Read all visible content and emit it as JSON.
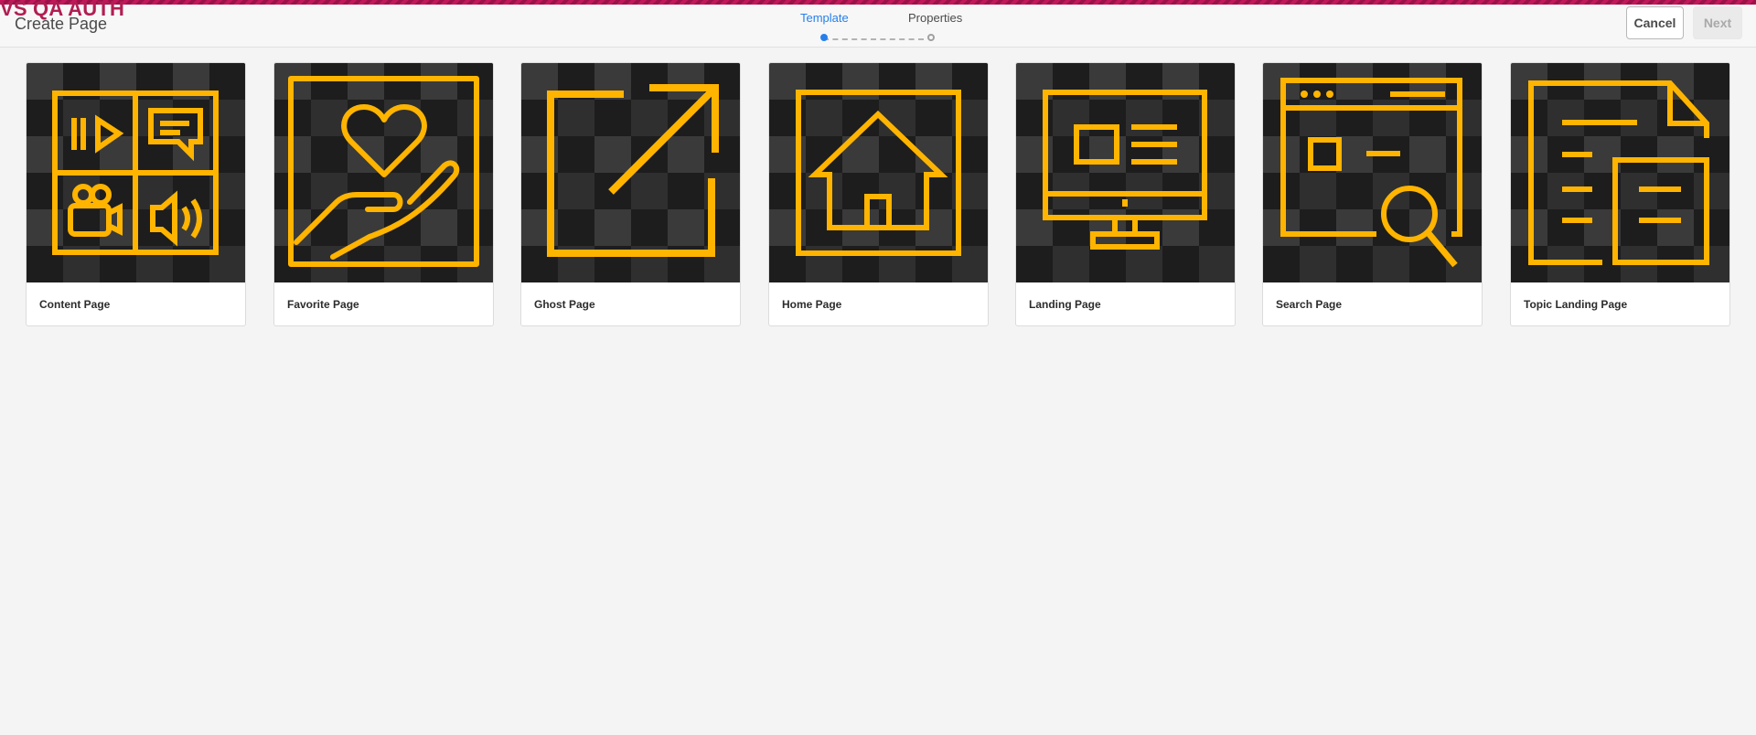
{
  "environment": {
    "label": "VS QA AUTH",
    "accent_color": "#b01e52"
  },
  "header": {
    "title": "Create Page",
    "steps": [
      {
        "label": "Template",
        "state": "active"
      },
      {
        "label": "Properties",
        "state": "upcoming"
      }
    ],
    "buttons": {
      "cancel": "Cancel",
      "next": "Next"
    }
  },
  "templates": [
    {
      "label": "Content Page",
      "icon": "media-grid-icon"
    },
    {
      "label": "Favorite Page",
      "icon": "heart-hand-icon"
    },
    {
      "label": "Ghost Page",
      "icon": "external-link-icon"
    },
    {
      "label": "Home Page",
      "icon": "home-icon"
    },
    {
      "label": "Landing Page",
      "icon": "desktop-monitor-icon"
    },
    {
      "label": "Search Page",
      "icon": "browser-search-icon"
    },
    {
      "label": "Topic Landing Page",
      "icon": "documents-icon"
    }
  ],
  "colors": {
    "icon": "#ffb400",
    "thumbnail_bg": "#2f2f2f",
    "primary": "#2680eb"
  }
}
